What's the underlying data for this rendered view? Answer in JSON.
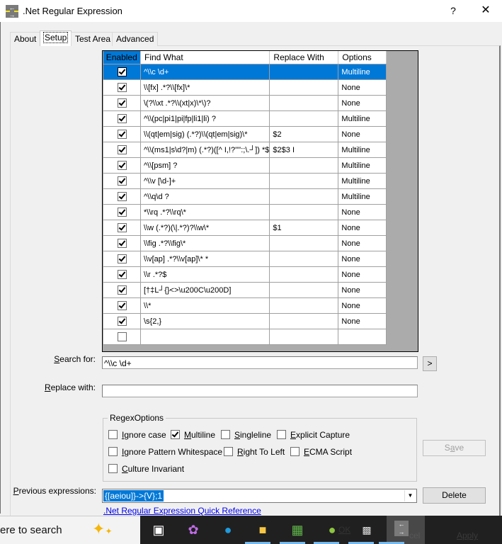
{
  "window": {
    "title": ".Net Regular Expression",
    "help_label": "?",
    "close_label": "✕",
    "icon": "regex-app-icon"
  },
  "tabs": [
    {
      "label": "About",
      "active": false
    },
    {
      "label": "Setup",
      "active": true
    },
    {
      "label": "Test Area",
      "active": false
    },
    {
      "label": "Advanced",
      "active": false
    }
  ],
  "grid": {
    "columns": [
      "Enabled",
      "Find What",
      "Replace With",
      "Options"
    ],
    "rows": [
      {
        "enabled": true,
        "find": "^\\\\c \\d+",
        "replace": "",
        "options": "Multiline",
        "selected": true
      },
      {
        "enabled": true,
        "find": "\\\\[fx] .*?\\\\[fx]\\*",
        "replace": "",
        "options": "None"
      },
      {
        "enabled": true,
        "find": "\\(?\\\\xt .*?\\\\(xt|x)\\*\\)?",
        "replace": "",
        "options": "None"
      },
      {
        "enabled": true,
        "find": "^\\\\(pc|pi1|pi|fp|li1|li) ?",
        "replace": "",
        "options": "Multiline"
      },
      {
        "enabled": true,
        "find": "\\\\(qt|em|sig) (.*?)\\\\(qt|em|sig)\\*",
        "replace": "$2",
        "options": "None"
      },
      {
        "enabled": true,
        "find": "^\\\\(ms1|s\\d?|m) (.*?)([^ I,!?'\"':;\\.┘]) *$",
        "replace": "$2$3 I",
        "options": "Multiline"
      },
      {
        "enabled": true,
        "find": "^\\\\[psm] ?",
        "replace": "",
        "options": "Multiline"
      },
      {
        "enabled": true,
        "find": "^\\\\v [\\d-]+",
        "replace": "",
        "options": "Multiline"
      },
      {
        "enabled": true,
        "find": "^\\\\q\\d ?",
        "replace": "",
        "options": "Multiline"
      },
      {
        "enabled": true,
        "find": " *\\\\rq .*?\\\\rq\\*",
        "replace": "",
        "options": "None"
      },
      {
        "enabled": true,
        "find": "\\\\w (.*?)(\\|.*?)?\\\\w\\*",
        "replace": "$1",
        "options": "None"
      },
      {
        "enabled": true,
        "find": "\\\\fig .*?\\\\fig\\*",
        "replace": "",
        "options": "None"
      },
      {
        "enabled": true,
        "find": "\\\\v[ap] .*?\\\\v[ap]\\* *",
        "replace": "",
        "options": "None"
      },
      {
        "enabled": true,
        "find": "\\\\r .*?$",
        "replace": "",
        "options": "None"
      },
      {
        "enabled": true,
        "find": "[†‡L┘{}<>\\u200C\\u200D]",
        "replace": "",
        "options": "None"
      },
      {
        "enabled": true,
        "find": "\\\\*",
        "replace": "",
        "options": "None"
      },
      {
        "enabled": true,
        "find": "\\s{2,}",
        "replace": "",
        "options": "None"
      },
      {
        "enabled": false,
        "find": "",
        "replace": "",
        "options": ""
      }
    ]
  },
  "search": {
    "label_access": "S",
    "label_rest": "earch for:",
    "value": "^\\\\c \\d+",
    "go_label": ">"
  },
  "replace": {
    "label_access": "R",
    "label_rest": "eplace with:",
    "value": ""
  },
  "regex_options": {
    "title": "RegexOptions",
    "items": [
      {
        "access": "I",
        "rest": "gnore case",
        "checked": false
      },
      {
        "access": "M",
        "rest": "ultiline",
        "checked": true
      },
      {
        "access": "S",
        "rest": "ingleline",
        "checked": false
      },
      {
        "access": "E",
        "rest": "xplicit Capture",
        "checked": false
      },
      {
        "access": "I",
        "rest": "gnore Pattern Whitespace",
        "checked": false
      },
      {
        "access": "R",
        "rest": "ight To Left",
        "checked": false
      },
      {
        "access": "E",
        "rest": "CMA Script",
        "checked": false
      },
      {
        "access": "C",
        "rest": "ulture Invariant",
        "checked": false
      }
    ]
  },
  "save_button": {
    "pre": "S",
    "access": "a",
    "post": "ve",
    "enabled": false
  },
  "previous": {
    "label_access": "P",
    "label_rest": "revious expressions:",
    "value": "{[aeiou]}->{V};1",
    "delete_label": "Delete"
  },
  "quick_reference_link": ".Net Regular Expression Quick Reference",
  "dialog_buttons_partial": {
    "ok": "OK",
    "cancel_fragment": "cel",
    "apply": "Apply"
  },
  "taskbar": {
    "search_text": "ere to search",
    "icons": [
      "copilot-sparkle-icon",
      "task-view-icon",
      "copilot-icon",
      "edge-icon",
      "file-explorer-icon",
      "notepad-icon",
      "leaf-app-icon",
      "terminal-icon",
      "regex-app-icon"
    ]
  }
}
